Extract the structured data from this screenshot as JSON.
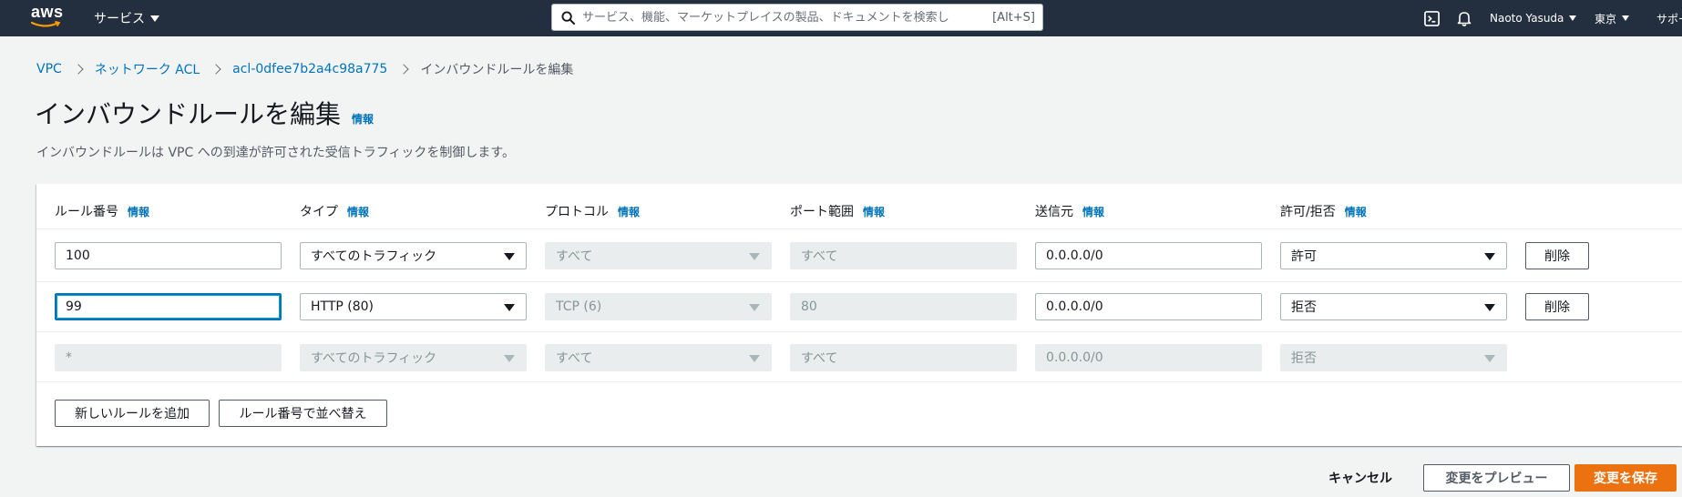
{
  "nav": {
    "logo_text": "aws",
    "services_label": "サービス",
    "search_placeholder": "サービス、機能、マーケットプレイスの製品、ドキュメントを検索し",
    "search_shortcut": "[Alt+S]",
    "user_label": "Naoto Yasuda",
    "region_label": "東京",
    "support_label": "サポート"
  },
  "breadcrumb": {
    "items": [
      "VPC",
      "ネットワーク ACL",
      "acl-0dfee7b2a4c98a775"
    ],
    "current": "インバウンドルールを編集"
  },
  "header": {
    "title": "インバウンドルールを編集",
    "info_label": "情報",
    "description": "インバウンドルールは VPC への到達が許可された受信トラフィックを制御します。"
  },
  "table": {
    "columns": [
      {
        "label": "ルール番号",
        "info": "情報"
      },
      {
        "label": "タイプ",
        "info": "情報"
      },
      {
        "label": "プロトコル",
        "info": "情報"
      },
      {
        "label": "ポート範囲",
        "info": "情報"
      },
      {
        "label": "送信元",
        "info": "情報"
      },
      {
        "label": "許可/拒否",
        "info": "情報"
      }
    ],
    "rows": [
      {
        "rule_number": "100",
        "type": "すべてのトラフィック",
        "protocol": "すべて",
        "port_range": "すべて",
        "source": "0.0.0.0/0",
        "action": "許可",
        "delete_label": "削除"
      },
      {
        "rule_number": "99",
        "type": "HTTP (80)",
        "protocol": "TCP (6)",
        "port_range": "80",
        "source": "0.0.0.0/0",
        "action": "拒否",
        "delete_label": "削除"
      },
      {
        "rule_number": "*",
        "type": "すべてのトラフィック",
        "protocol": "すべて",
        "port_range": "すべて",
        "source": "0.0.0.0/0",
        "action": "拒否"
      }
    ],
    "add_rule_label": "新しいルールを追加",
    "sort_label": "ルール番号で並べ替え"
  },
  "footer": {
    "cancel_label": "キャンセル",
    "preview_label": "変更をプレビュー",
    "save_label": "変更を保存"
  },
  "colors": {
    "nav_bg": "#232f3e",
    "link": "#0073bb",
    "primary": "#ec7211",
    "page_bg": "#f2f3f3"
  }
}
